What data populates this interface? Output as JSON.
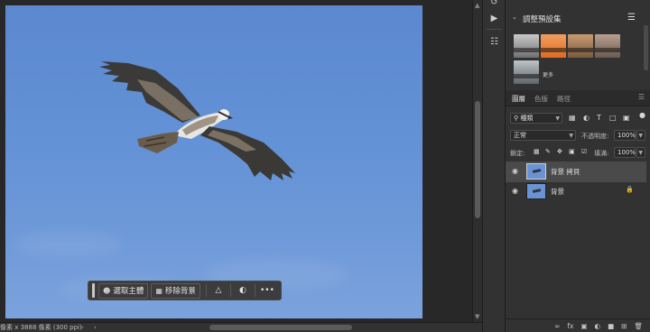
{
  "status_bar": {
    "document_info": "像素 x 3888 像素 (300 ppi)",
    "expand_label": "›",
    "scroll_left_label": "‹"
  },
  "task_bar": {
    "select_subject_label": "選取主體",
    "remove_bg_label": "移除背景",
    "more_label": "•••"
  },
  "adjustment_presets": {
    "title": "調整預設集",
    "more_label": "更多",
    "thumbs": [
      {
        "top": "#c9c9c9",
        "bottom": "#6f6f6f"
      },
      {
        "top": "#f0a060",
        "bottom": "#e06a20"
      },
      {
        "top": "#c99a70",
        "bottom": "#7a5a40"
      },
      {
        "top": "#b8a090",
        "bottom": "#6a5a50"
      },
      {
        "top": "#bfc4c9",
        "bottom": "#5f6469"
      }
    ]
  },
  "layers_panel": {
    "tabs": [
      "圖層",
      "色版",
      "路徑"
    ],
    "filter_kind": "種類",
    "blend_mode": "正常",
    "opacity_label": "不透明度:",
    "opacity_value": "100%",
    "lock_label": "鎖定:",
    "fill_label": "填滿:",
    "fill_value": "100%",
    "layers": [
      {
        "name": "背景 拷貝",
        "selected": true
      },
      {
        "name": "背景",
        "selected": false,
        "locked": true
      }
    ],
    "footer_fx": "fx"
  },
  "colors": {
    "sky_top": "#5b88cf",
    "sky_bottom": "#7ba2dc",
    "panel_bg": "#323232",
    "selected_layer": "#4a4a4a"
  }
}
